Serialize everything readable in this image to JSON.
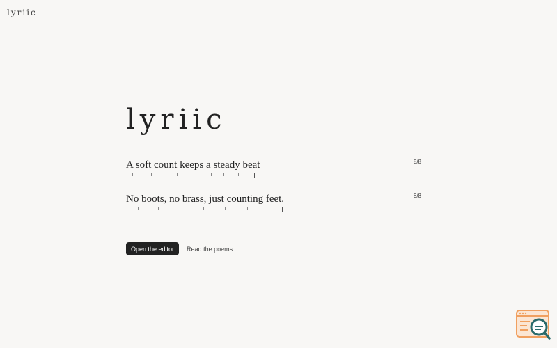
{
  "brand": {
    "small_logo": "lyriic",
    "hero_title": "lyriic"
  },
  "lines": [
    {
      "text": "A soft count keeps a steady beat",
      "count": "8/8",
      "beats": 8
    },
    {
      "text": "No boots, no brass, just counting feet.",
      "count": "8/8",
      "beats": 8
    }
  ],
  "actions": {
    "primary_label": "Open the editor",
    "secondary_label": "Read the poems"
  },
  "colors": {
    "background": "#f8f7f5",
    "text": "#222222",
    "button_bg": "#222222",
    "icon_accent": "#f0a060",
    "icon_teal": "#2a6b6b"
  },
  "icons": {
    "corner": "inspect-search-icon"
  }
}
